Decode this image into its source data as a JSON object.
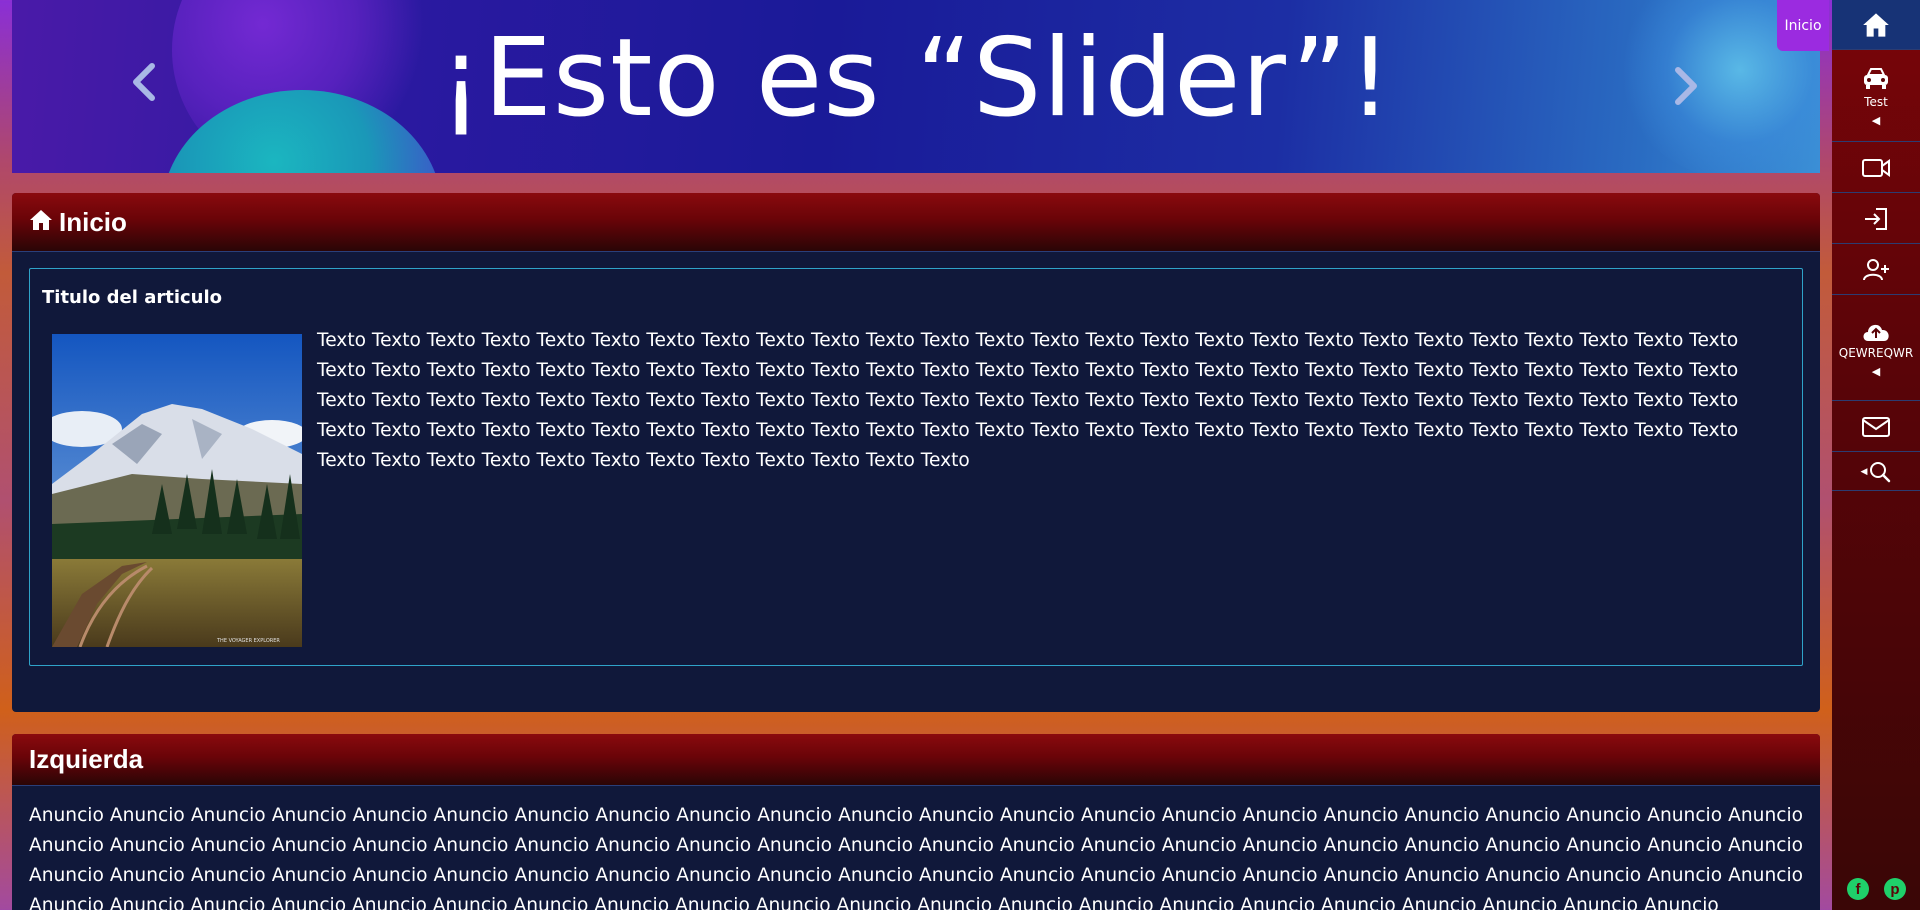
{
  "slider": {
    "title": "¡Esto es “Slider”!",
    "prev_icon": "chevron-left-icon",
    "next_icon": "chevron-right-icon"
  },
  "panel_inicio": {
    "title": "Inicio",
    "icon": "house-icon",
    "article": {
      "title": "Titulo del articulo",
      "image_caption": "THE VOYAGER EXPLORER",
      "text": "Texto Texto Texto Texto Texto Texto Texto Texto Texto Texto Texto Texto Texto Texto Texto Texto Texto Texto Texto Texto Texto Texto Texto Texto Texto Texto Texto Texto Texto Texto Texto Texto Texto Texto Texto Texto Texto Texto Texto Texto Texto Texto Texto Texto Texto Texto Texto Texto Texto Texto Texto Texto Texto Texto Texto Texto Texto Texto Texto Texto Texto Texto Texto Texto Texto Texto Texto Texto Texto Texto Texto Texto Texto Texto Texto Texto Texto Texto Texto Texto Texto Texto Texto Texto Texto Texto Texto Texto Texto Texto Texto Texto Texto Texto Texto Texto Texto Texto Texto Texto Texto Texto Texto Texto Texto Texto Texto Texto Texto Texto Texto Texto Texto Texto Texto Texto"
    }
  },
  "panel_izquierda": {
    "title": "Izquierda",
    "text": "Anuncio Anuncio Anuncio Anuncio Anuncio Anuncio Anuncio Anuncio Anuncio Anuncio Anuncio Anuncio Anuncio Anuncio Anuncio Anuncio Anuncio Anuncio Anuncio Anuncio Anuncio Anuncio Anuncio Anuncio Anuncio Anuncio Anuncio Anuncio Anuncio Anuncio Anuncio Anuncio Anuncio Anuncio Anuncio Anuncio Anuncio Anuncio Anuncio Anuncio Anuncio Anuncio Anuncio Anuncio Anuncio Anuncio Anuncio Anuncio Anuncio Anuncio Anuncio Anuncio Anuncio Anuncio Anuncio Anuncio Anuncio Anuncio Anuncio Anuncio Anuncio Anuncio Anuncio Anuncio Anuncio Anuncio Anuncio Anuncio Anuncio Anuncio Anuncio Anuncio Anuncio Anuncio Anuncio Anuncio Anuncio Anuncio Anuncio Anuncio Anuncio Anuncio Anuncio Anuncio Anuncio Anuncio Anuncio"
  },
  "sidebar": {
    "tooltip": "Inicio",
    "items": [
      {
        "icon": "house-icon"
      },
      {
        "icon": "taxi-icon",
        "label": "Test"
      },
      {
        "icon": "video-camera-icon"
      },
      {
        "icon": "sign-in-icon"
      },
      {
        "icon": "add-user-icon"
      },
      {
        "icon": "cloud-upload-icon",
        "label": "QEWREQWR"
      },
      {
        "icon": "envelope-icon"
      },
      {
        "icon": "search-icon"
      }
    ],
    "social": [
      {
        "icon": "facebook-icon"
      },
      {
        "icon": "pinterest-icon"
      }
    ]
  },
  "colors": {
    "panel_body": "#10183a",
    "panel_header": "#6a0408",
    "article_border": "#2fa3c9",
    "tooltip": "#9b2be0",
    "sidebar_home": "#173376",
    "social": "#1fd06a"
  }
}
